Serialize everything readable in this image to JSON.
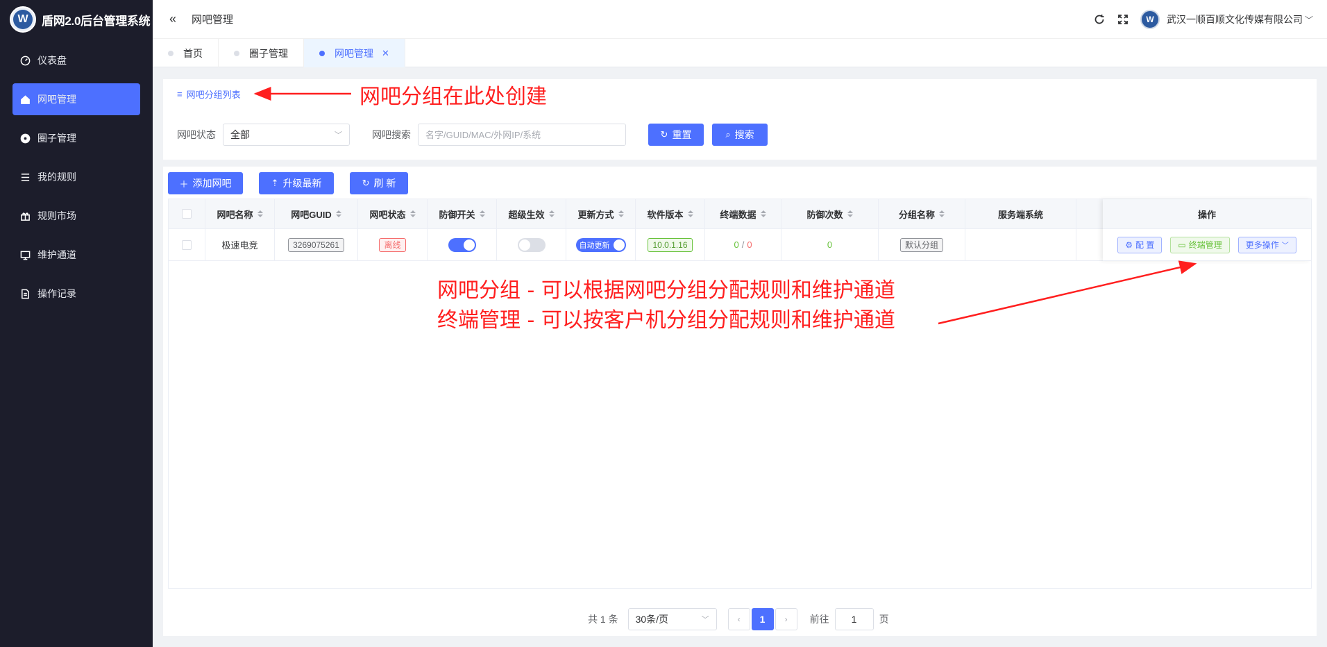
{
  "app": {
    "title": "盾网2.0后台管理系统",
    "logo_letter": "W"
  },
  "sidebar": {
    "items": [
      {
        "label": "仪表盘",
        "icon": "dashboard-icon"
      },
      {
        "label": "网吧管理",
        "icon": "home-icon",
        "active": true
      },
      {
        "label": "圈子管理",
        "icon": "circle-icon"
      },
      {
        "label": "我的规则",
        "icon": "list-icon"
      },
      {
        "label": "规则市场",
        "icon": "gift-icon"
      },
      {
        "label": "维护通道",
        "icon": "monitor-icon"
      },
      {
        "label": "操作记录",
        "icon": "document-icon"
      }
    ]
  },
  "header": {
    "breadcrumb": "网吧管理",
    "company": "武汉一顺百顺文化传媒有限公司",
    "avatar_letter": "W"
  },
  "tabs": [
    {
      "label": "首页"
    },
    {
      "label": "圈子管理"
    },
    {
      "label": "网吧管理",
      "active": true
    }
  ],
  "search": {
    "group_link": "网吧分组列表",
    "status_label": "网吧状态",
    "status_value": "全部",
    "search_label": "网吧搜索",
    "search_placeholder": "名字/GUID/MAC/外网IP/系统",
    "reset_label": "重置",
    "search_button": "搜索"
  },
  "toolbar": {
    "add_label": "添加网吧",
    "upgrade_label": "升级最新",
    "refresh_label": "刷 新"
  },
  "table": {
    "columns": [
      "网吧名称",
      "网吧GUID",
      "网吧状态",
      "防御开关",
      "超级生效",
      "更新方式",
      "软件版本",
      "终端数据",
      "防御次数",
      "分组名称",
      "服务端系统"
    ],
    "ops_header": "操作",
    "rows": [
      {
        "name": "极速电竞",
        "guid": "3269075261",
        "status": "离线",
        "defense_on": true,
        "super_on": false,
        "update_mode": "自动更新",
        "version": "10.0.1.16",
        "term_online": "0",
        "term_sep": "/",
        "term_total": "0",
        "defense_count": "0",
        "group": "默认分组",
        "server_os": ""
      }
    ],
    "ops": {
      "config": "配 置",
      "terminal": "终端管理",
      "more": "更多操作"
    }
  },
  "pagination": {
    "total": "共 1 条",
    "page_size": "30条/页",
    "current_page": "1",
    "goto_label": "前往",
    "goto_value": "1",
    "page_unit": "页"
  },
  "annotations": {
    "group_note": "网吧分组在此处创建",
    "line1": "网吧分组 - 可以根据网吧分组分配规则和维护通道",
    "line2": "终端管理 - 可以按客户机分组分配规则和维护通道",
    "color": "#ff1f1f"
  },
  "colors": {
    "primary": "#4d70ff",
    "sidebar_bg": "#1c1d2b",
    "success": "#67c23a",
    "danger": "#f56c6c"
  }
}
